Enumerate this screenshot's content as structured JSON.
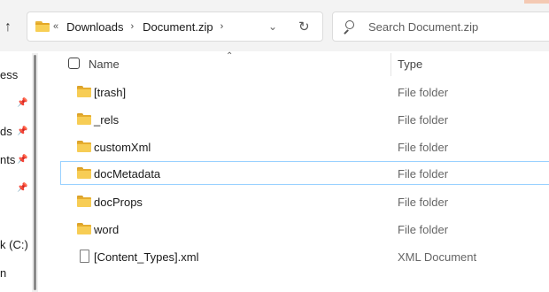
{
  "address_bar": {
    "overflow_label": "«",
    "crumbs": [
      "Downloads",
      "Document.zip"
    ],
    "separator": "›"
  },
  "search": {
    "placeholder": "Search Document.zip"
  },
  "nav": {
    "items": [
      {
        "label": "ess",
        "pinned": false
      },
      {
        "label": "",
        "pinned": true
      },
      {
        "label": "ds",
        "pinned": true
      },
      {
        "label": "nts",
        "pinned": true
      },
      {
        "label": "",
        "pinned": true
      },
      {
        "label": "k (C:)",
        "pinned": false
      },
      {
        "label": "n",
        "pinned": false
      }
    ]
  },
  "columns": {
    "name": "Name",
    "type": "Type"
  },
  "files": [
    {
      "name": "[trash]",
      "type": "File folder",
      "icon": "folder-icon"
    },
    {
      "name": "_rels",
      "type": "File folder",
      "icon": "folder-icon"
    },
    {
      "name": "customXml",
      "type": "File folder",
      "icon": "folder-icon"
    },
    {
      "name": "docMetadata",
      "type": "File folder",
      "icon": "folder-icon",
      "selected": true
    },
    {
      "name": "docProps",
      "type": "File folder",
      "icon": "folder-icon"
    },
    {
      "name": "word",
      "type": "File folder",
      "icon": "folder-icon"
    },
    {
      "name": "[Content_Types].xml",
      "type": "XML Document",
      "icon": "document-icon"
    }
  ],
  "colors": {
    "folder": "#f7cd55",
    "selection_border": "#99d1ff",
    "accent": "#f4c9b3"
  }
}
